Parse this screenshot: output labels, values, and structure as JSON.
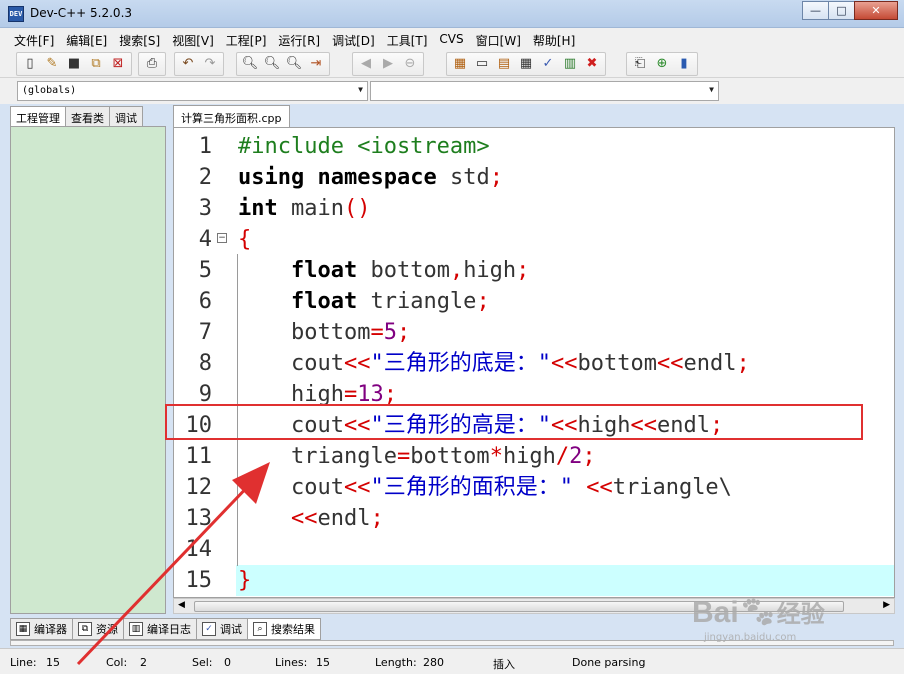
{
  "window": {
    "title": "Dev-C++ 5.2.0.3",
    "icon_label": "DEV"
  },
  "menu": [
    "文件[F]",
    "编辑[E]",
    "搜索[S]",
    "视图[V]",
    "工程[P]",
    "运行[R]",
    "调试[D]",
    "工具[T]",
    "CVS",
    "窗口[W]",
    "帮助[H]"
  ],
  "classbar": {
    "scope": "(globals)",
    "members": ""
  },
  "left_tabs": [
    "工程管理",
    "查看类",
    "调试"
  ],
  "editor": {
    "tab": "计算三角形面积.cpp",
    "lines": [
      {
        "n": "1",
        "html": "<span class=\"pp\">#include &lt;iostream&gt;</span>"
      },
      {
        "n": "2",
        "html": "<span class=\"kw\">using</span> <span class=\"kw\">namespace</span> std<span class=\"op\">;</span>"
      },
      {
        "n": "3",
        "html": "<span class=\"kw\">int</span> main<span class=\"op\">()</span>"
      },
      {
        "n": "4",
        "html": "<span class=\"op\">{</span>"
      },
      {
        "n": "5",
        "html": "    <span class=\"kw\">float</span> bottom<span class=\"op\">,</span>high<span class=\"op\">;</span>"
      },
      {
        "n": "6",
        "html": "    <span class=\"kw\">float</span> triangle<span class=\"op\">;</span>"
      },
      {
        "n": "7",
        "html": "    bottom<span class=\"op\">=</span><span class=\"num\">5</span><span class=\"op\">;</span>"
      },
      {
        "n": "8",
        "html": "    cout<span class=\"op\">&lt;&lt;</span><span class=\"str\">\"三角形的底是：\"</span><span class=\"op\">&lt;&lt;</span>bottom<span class=\"op\">&lt;&lt;</span>endl<span class=\"op\">;</span>"
      },
      {
        "n": "9",
        "html": "    high<span class=\"op\">=</span><span class=\"num\">13</span><span class=\"op\">;</span>"
      },
      {
        "n": "10",
        "html": "    cout<span class=\"op\">&lt;&lt;</span><span class=\"str\">\"三角形的高是：\"</span><span class=\"op\">&lt;&lt;</span>high<span class=\"op\">&lt;&lt;</span>endl<span class=\"op\">;</span>"
      },
      {
        "n": "11",
        "html": "    triangle<span class=\"op\">=</span>bottom<span class=\"op\">*</span>high<span class=\"op\">/</span><span class=\"num\">2</span><span class=\"op\">;</span>"
      },
      {
        "n": "12",
        "html": "    cout<span class=\"op\">&lt;&lt;</span><span class=\"str\">\"三角形的面积是：\"</span> <span class=\"op\">&lt;&lt;</span>triangle\\"
      },
      {
        "n": "13",
        "html": "    <span class=\"op\">&lt;&lt;</span>endl<span class=\"op\">;</span>"
      },
      {
        "n": "14",
        "html": ""
      },
      {
        "n": "15",
        "html": "<span class=\"op\">}</span>"
      }
    ]
  },
  "bottom_tabs": [
    "编译器",
    "资源",
    "编译日志",
    "调试",
    "搜索结果"
  ],
  "status": {
    "line_label": "Line:",
    "line": "15",
    "col_label": "Col:",
    "col": "2",
    "sel_label": "Sel:",
    "sel": "0",
    "lines_label": "Lines:",
    "lines": "15",
    "length_label": "Length:",
    "length": "280",
    "mode": "插入",
    "message": "Done parsing"
  },
  "watermark": {
    "brand": "Bai",
    "brand_cn": "经验",
    "site": "jingyan.baidu.com"
  },
  "colors": {
    "annotation": "#e03030",
    "current_line": "#ccffff",
    "project_panel": "#cfe8cf"
  }
}
